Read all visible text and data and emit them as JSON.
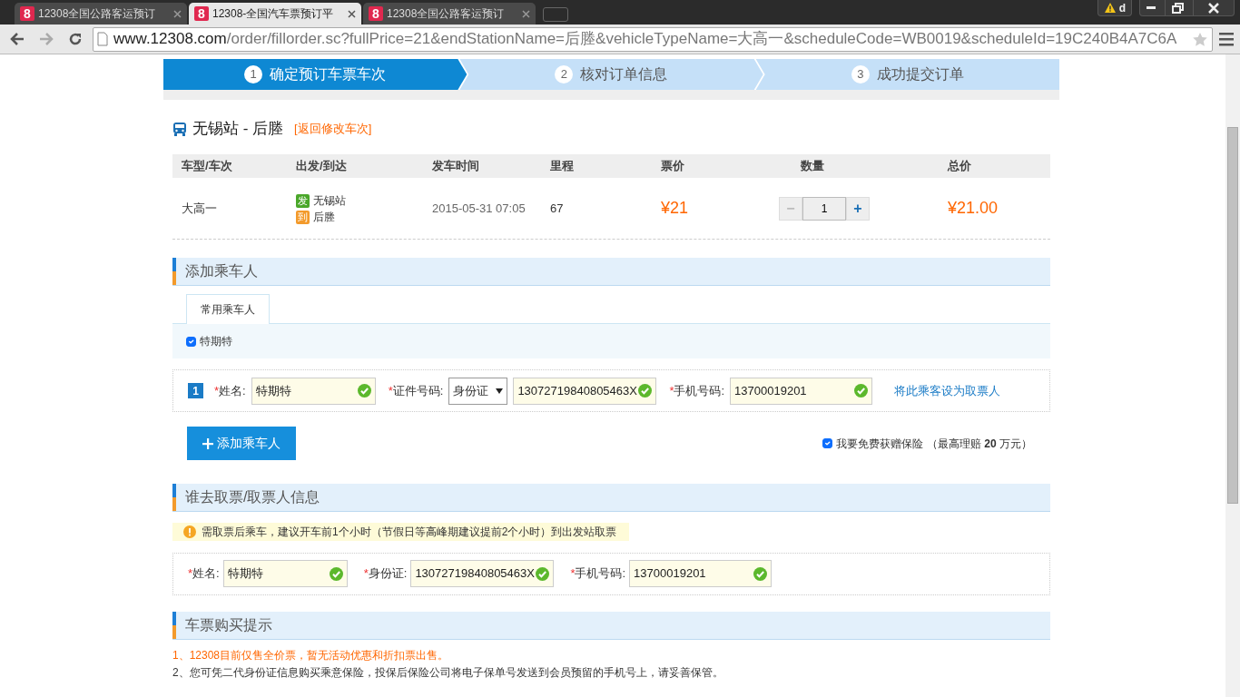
{
  "browser": {
    "tabs": [
      {
        "icon_text": "8",
        "title": "12308全国公路客运预订",
        "selected": false
      },
      {
        "icon_text": "8",
        "title": "12308-全国汽车票预订平",
        "selected": true
      },
      {
        "icon_text": "8",
        "title": "12308全国公路客运预订",
        "selected": false
      }
    ],
    "profile_badge": "d",
    "url_host": "www.12308.com",
    "url_path": "/order/fillorder.sc?fullPrice=21&endStationName=后塍&vehicleTypeName=大高一&scheduleCode=WB0019&scheduleId=19C240B4A7C6A"
  },
  "steps": [
    {
      "number": "1",
      "label": "确定预订车票车次",
      "selected": true
    },
    {
      "number": "2",
      "label": "核对订单信息",
      "selected": false
    },
    {
      "number": "3",
      "label": "成功提交订单",
      "selected": false
    }
  ],
  "route": {
    "title": "无锡站 - 后塍",
    "back_link": "[返回修改车次]"
  },
  "ticket_table": {
    "columns": [
      "车型/车次",
      "出发/到达",
      "发车时间",
      "里程",
      "票价",
      "数量",
      "总价"
    ],
    "row": {
      "vehicle": "大高一",
      "depart_badge": "发",
      "depart": "无锡站",
      "arrive_badge": "到",
      "arrive": "后塍",
      "time": "2015-05-31 07:05",
      "distance": "67",
      "price": "¥21",
      "minus": "−",
      "quantity": "1",
      "plus": "+",
      "total": "¥21.00"
    }
  },
  "passengers": {
    "title": "添加乘车人",
    "tabs": [
      {
        "label": "常用乘车人",
        "selected": true
      }
    ],
    "frequent": [
      {
        "name": "特期特",
        "checked": true
      }
    ],
    "list": [
      {
        "index": "1",
        "required_mark": "*",
        "name_label": "姓名:",
        "name": "特期特",
        "name_valid": true,
        "id_label": "证件号码:",
        "id_type": "身份证",
        "id_number": "13072719840805463X",
        "id_valid": true,
        "phone_label": "手机号码:",
        "phone": "13700019201",
        "phone_valid": true,
        "set_pickup_link": "将此乘客设为取票人"
      }
    ],
    "add_button": "添加乘车人",
    "insurance": {
      "checked": true,
      "label": "我要免费获赠保险",
      "note": "（最高理赔 **20** 万元）"
    }
  },
  "pickup": {
    "title": "谁去取票/取票人信息",
    "notice": "需取票后乘车，建议开车前1个小时（节假日等高峰期建议提前2个小时）到出发站取票",
    "fields": [
      {
        "required_mark": "*",
        "label": "姓名:",
        "value": "特期特",
        "valid": true
      },
      {
        "required_mark": "*",
        "label": "身份证:",
        "value": "13072719840805463X",
        "valid": true
      },
      {
        "required_mark": "*",
        "label": "手机号码:",
        "value": "13700019201",
        "valid": true
      }
    ]
  },
  "tips": {
    "title": "车票购买提示",
    "items": [
      {
        "kind": "highlight",
        "text": "1、12308目前仅售全价票，暂无活动优惠和折扣票出售。"
      },
      {
        "kind": "normal",
        "text": "2、您可凭二代身份证信息购买乘意保险，投保后保险公司将电子保单号发送到会员预留的手机号上，请妥善保管。"
      }
    ]
  }
}
